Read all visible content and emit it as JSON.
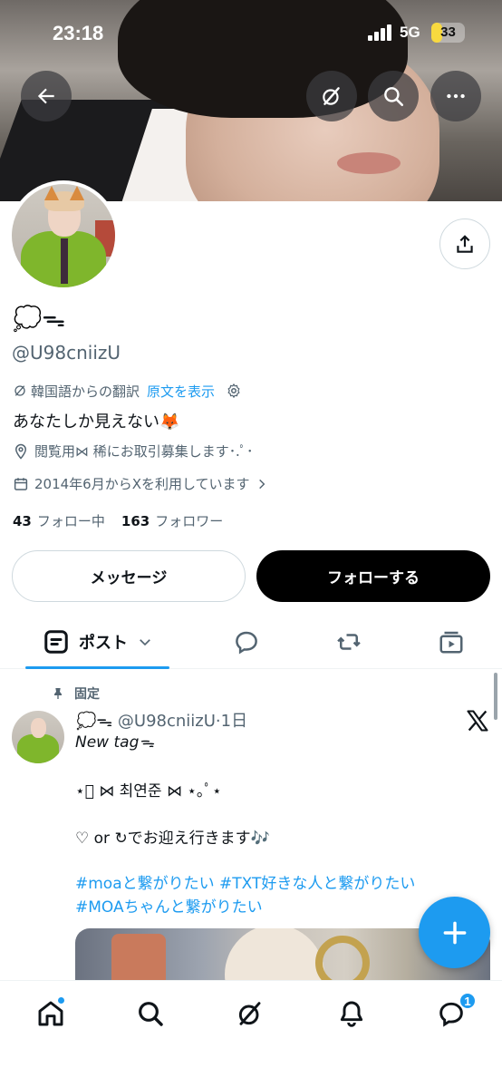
{
  "status_bar": {
    "time": "23:18",
    "network": "5G",
    "battery_label": "33",
    "battery_level": 0.33
  },
  "profile": {
    "display_name": "💭ᯓ",
    "handle": "@U98cniizU",
    "translation_note": "韓国語からの翻訳",
    "show_original": "原文を表示",
    "bio": "あなたしか見えない🦊",
    "location": "閲覧用⋈  稀にお取引募集します･.ﾟ･",
    "joined": "2014年6月からXを利用しています",
    "following_count": "43",
    "following_label": "フォロー中",
    "followers_count": "163",
    "followers_label": "フォロワー",
    "message_button": "メッセージ",
    "follow_button": "フォローする"
  },
  "tabs": {
    "posts_label": "ポスト"
  },
  "post": {
    "pinned_label": "固定",
    "author_name": "💭ᯓ",
    "author_handle": "@U98cniizU",
    "time": "1日",
    "line1": "New tagᯓ",
    "line2": "⋆ﾟ ⋈  최연준  ⋈ ⋆｡ﾟ⋆",
    "line3": "♡ or ↻でお迎え行きます🎶",
    "hashtag_line1": "#moaと繋がりたい #TXT好きな人と繋がりたい",
    "hashtag_line2": "#MOAちゃんと繋がりたい"
  },
  "bottom_nav": {
    "messages_badge": "1"
  },
  "colors": {
    "accent": "#1d9bf0",
    "text": "#0f1419",
    "muted": "#536471"
  },
  "icons": [
    "back-arrow-icon",
    "grok-icon",
    "search-icon",
    "more-icon",
    "share-icon",
    "translate-icon",
    "gear-icon",
    "location-icon",
    "calendar-icon",
    "chevron-right-icon",
    "posts-icon",
    "chevron-down-icon",
    "reply-icon",
    "repost-icon",
    "media-icon",
    "pin-icon",
    "x-logo-icon",
    "plus-icon",
    "home-icon",
    "bell-icon",
    "messages-icon"
  ]
}
